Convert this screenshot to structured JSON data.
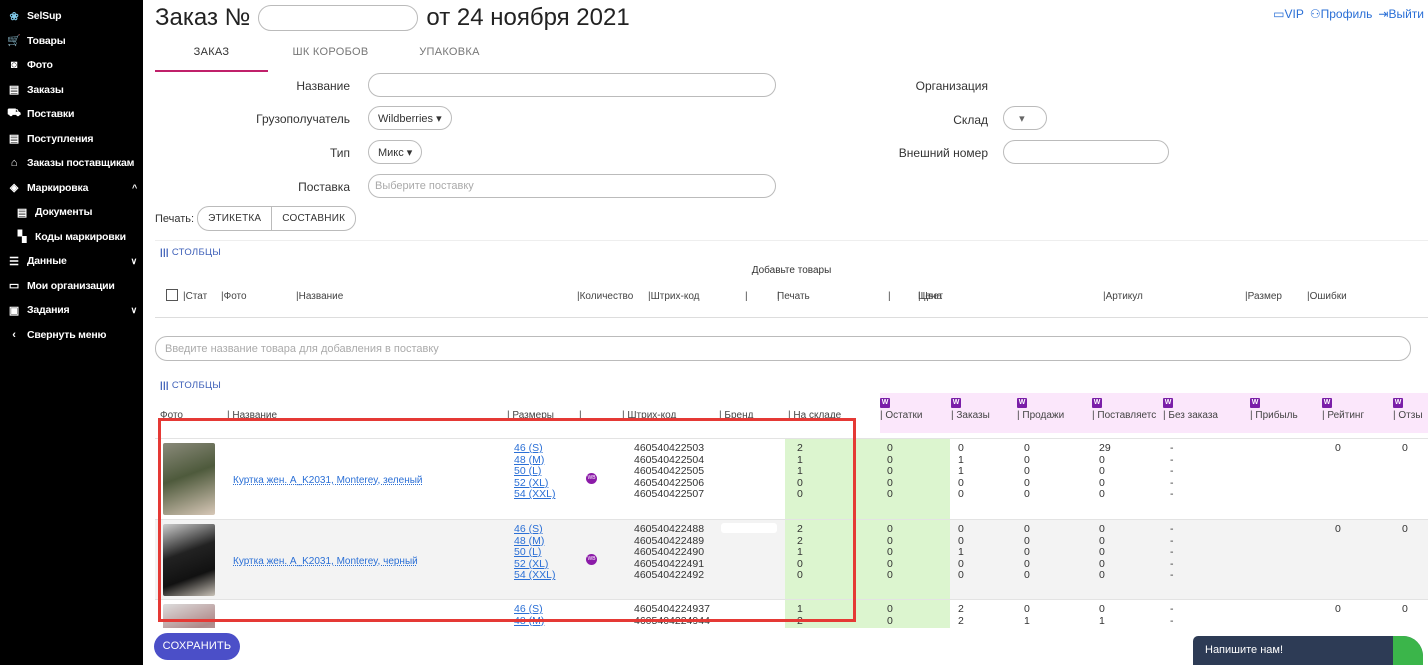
{
  "sidebar": {
    "items": [
      {
        "label": "SelSup",
        "icon": "selsup-logo-icon"
      },
      {
        "label": "Товары",
        "icon": "cart-icon"
      },
      {
        "label": "Фото",
        "icon": "camera-icon"
      },
      {
        "label": "Заказы",
        "icon": "list-icon"
      },
      {
        "label": "Поставки",
        "icon": "truck-icon"
      },
      {
        "label": "Поступления",
        "icon": "document-icon"
      },
      {
        "label": "Заказы поставщикам",
        "icon": "store-icon"
      },
      {
        "label": "Маркировка",
        "icon": "tag-icon"
      },
      {
        "label": "Документы",
        "icon": "document-icon"
      },
      {
        "label": "Коды маркировки",
        "icon": "codes-icon"
      },
      {
        "label": "Данные",
        "icon": "data-icon"
      },
      {
        "label": "Мои организации",
        "icon": "organization-icon"
      },
      {
        "label": "Задания",
        "icon": "clipboard-icon"
      },
      {
        "label": "Свернуть меню",
        "icon": "chevron-left-icon"
      }
    ]
  },
  "header": {
    "title_prefix": "Заказ №",
    "title_suffix": "от 24 ноября 2021",
    "links": {
      "vip": "VIP",
      "profile": "Профиль",
      "logout": "Выйти"
    }
  },
  "tabs": [
    "ЗАКАЗ",
    "ШК КОРОБОВ",
    "УПАКОВКА"
  ],
  "form": {
    "name_label": "Название",
    "consignee_label": "Грузополучатель",
    "consignee_value": "Wildberries",
    "type_label": "Тип",
    "type_value": "Микс",
    "supply_label": "Поставка",
    "supply_placeholder": "Выберите поставку",
    "org_label": "Организация",
    "warehouse_label": "Склад",
    "external_label": "Внешний номер"
  },
  "print": {
    "label": "Печать:",
    "label_btn": "ЭТИКЕТКА",
    "composite_btn": "СОСТАВНИК"
  },
  "panel1": {
    "columns_link": "СТОЛБЦЫ",
    "empty_message": "Добавьте товары",
    "headers": [
      "Стат",
      "Фото",
      "Название",
      "Количество",
      "Штрих-код",
      "Печать",
      "Цена",
      "Цвет",
      "Артикул",
      "Размер",
      "Ошибки"
    ]
  },
  "product_search_placeholder": "Введите название товара для добавления в поставку",
  "panel2": {
    "columns_link": "СТОЛБЦЫ",
    "headers": [
      "Фото",
      "Название",
      "Размеры",
      "Штрих-код",
      "Бренд",
      "На складе",
      "Остатки",
      "Заказы",
      "Продажи",
      "Поставляетс",
      "Без заказа",
      "Прибыль",
      "Рейтинг",
      "Отзы"
    ],
    "wb_badge": "W"
  },
  "products": [
    {
      "name": "Куртка жен. A_K2031, Monterey, зеленый",
      "sizes": [
        "46 (S)",
        "48 (M)",
        "50 (L)",
        "52 (XL)",
        "54 (XXL)"
      ],
      "barcodes": [
        "460540422503",
        "460540422504",
        "460540422505",
        "460540422506",
        "460540422507"
      ],
      "stock": [
        "2",
        "1",
        "1",
        "0",
        "0"
      ],
      "remains": [
        "0",
        "0",
        "0",
        "0",
        "0"
      ],
      "orders": [
        "0",
        "1",
        "1",
        "0",
        "0"
      ],
      "sales": [
        "0",
        "0",
        "0",
        "0",
        "0"
      ],
      "supplied": [
        "29",
        "0",
        "0",
        "0",
        "0"
      ],
      "no_order": [
        "-",
        "-",
        "-",
        "-",
        "-"
      ],
      "rating": "0",
      "reviews": "0"
    },
    {
      "name": "Куртка жен. A_K2031, Monterey, черный",
      "sizes": [
        "46 (S)",
        "48 (M)",
        "50 (L)",
        "52 (XL)",
        "54 (XXL)"
      ],
      "barcodes": [
        "460540422488",
        "460540422489",
        "460540422490",
        "460540422491",
        "460540422492"
      ],
      "stock": [
        "2",
        "2",
        "1",
        "0",
        "0"
      ],
      "remains": [
        "0",
        "0",
        "0",
        "0",
        "0"
      ],
      "orders": [
        "0",
        "0",
        "1",
        "0",
        "0"
      ],
      "sales": [
        "0",
        "0",
        "0",
        "0",
        "0"
      ],
      "supplied": [
        "0",
        "0",
        "0",
        "0",
        "0"
      ],
      "no_order": [
        "-",
        "-",
        "-",
        "-",
        "-"
      ],
      "rating": "0",
      "reviews": "0"
    },
    {
      "name": "",
      "sizes": [
        "46 (S)",
        "48 (M)"
      ],
      "barcodes": [
        "4605404224937",
        "4605404224944"
      ],
      "stock": [
        "1",
        "2"
      ],
      "remains": [
        "0",
        "0"
      ],
      "orders": [
        "2",
        "2"
      ],
      "sales": [
        "0",
        "1"
      ],
      "supplied": [
        "0",
        "1"
      ],
      "no_order": [
        "-",
        "-"
      ],
      "rating": "0",
      "reviews": "0"
    }
  ],
  "save_button": "СОХРАНИТЬ",
  "chat_widget": "Напишите нам!",
  "colors": {
    "accent": "#c0206a",
    "link": "#2a6fd6",
    "save": "#4b4fc8",
    "highlight": "#e53935",
    "stock_bg": "#dcf5cf"
  }
}
